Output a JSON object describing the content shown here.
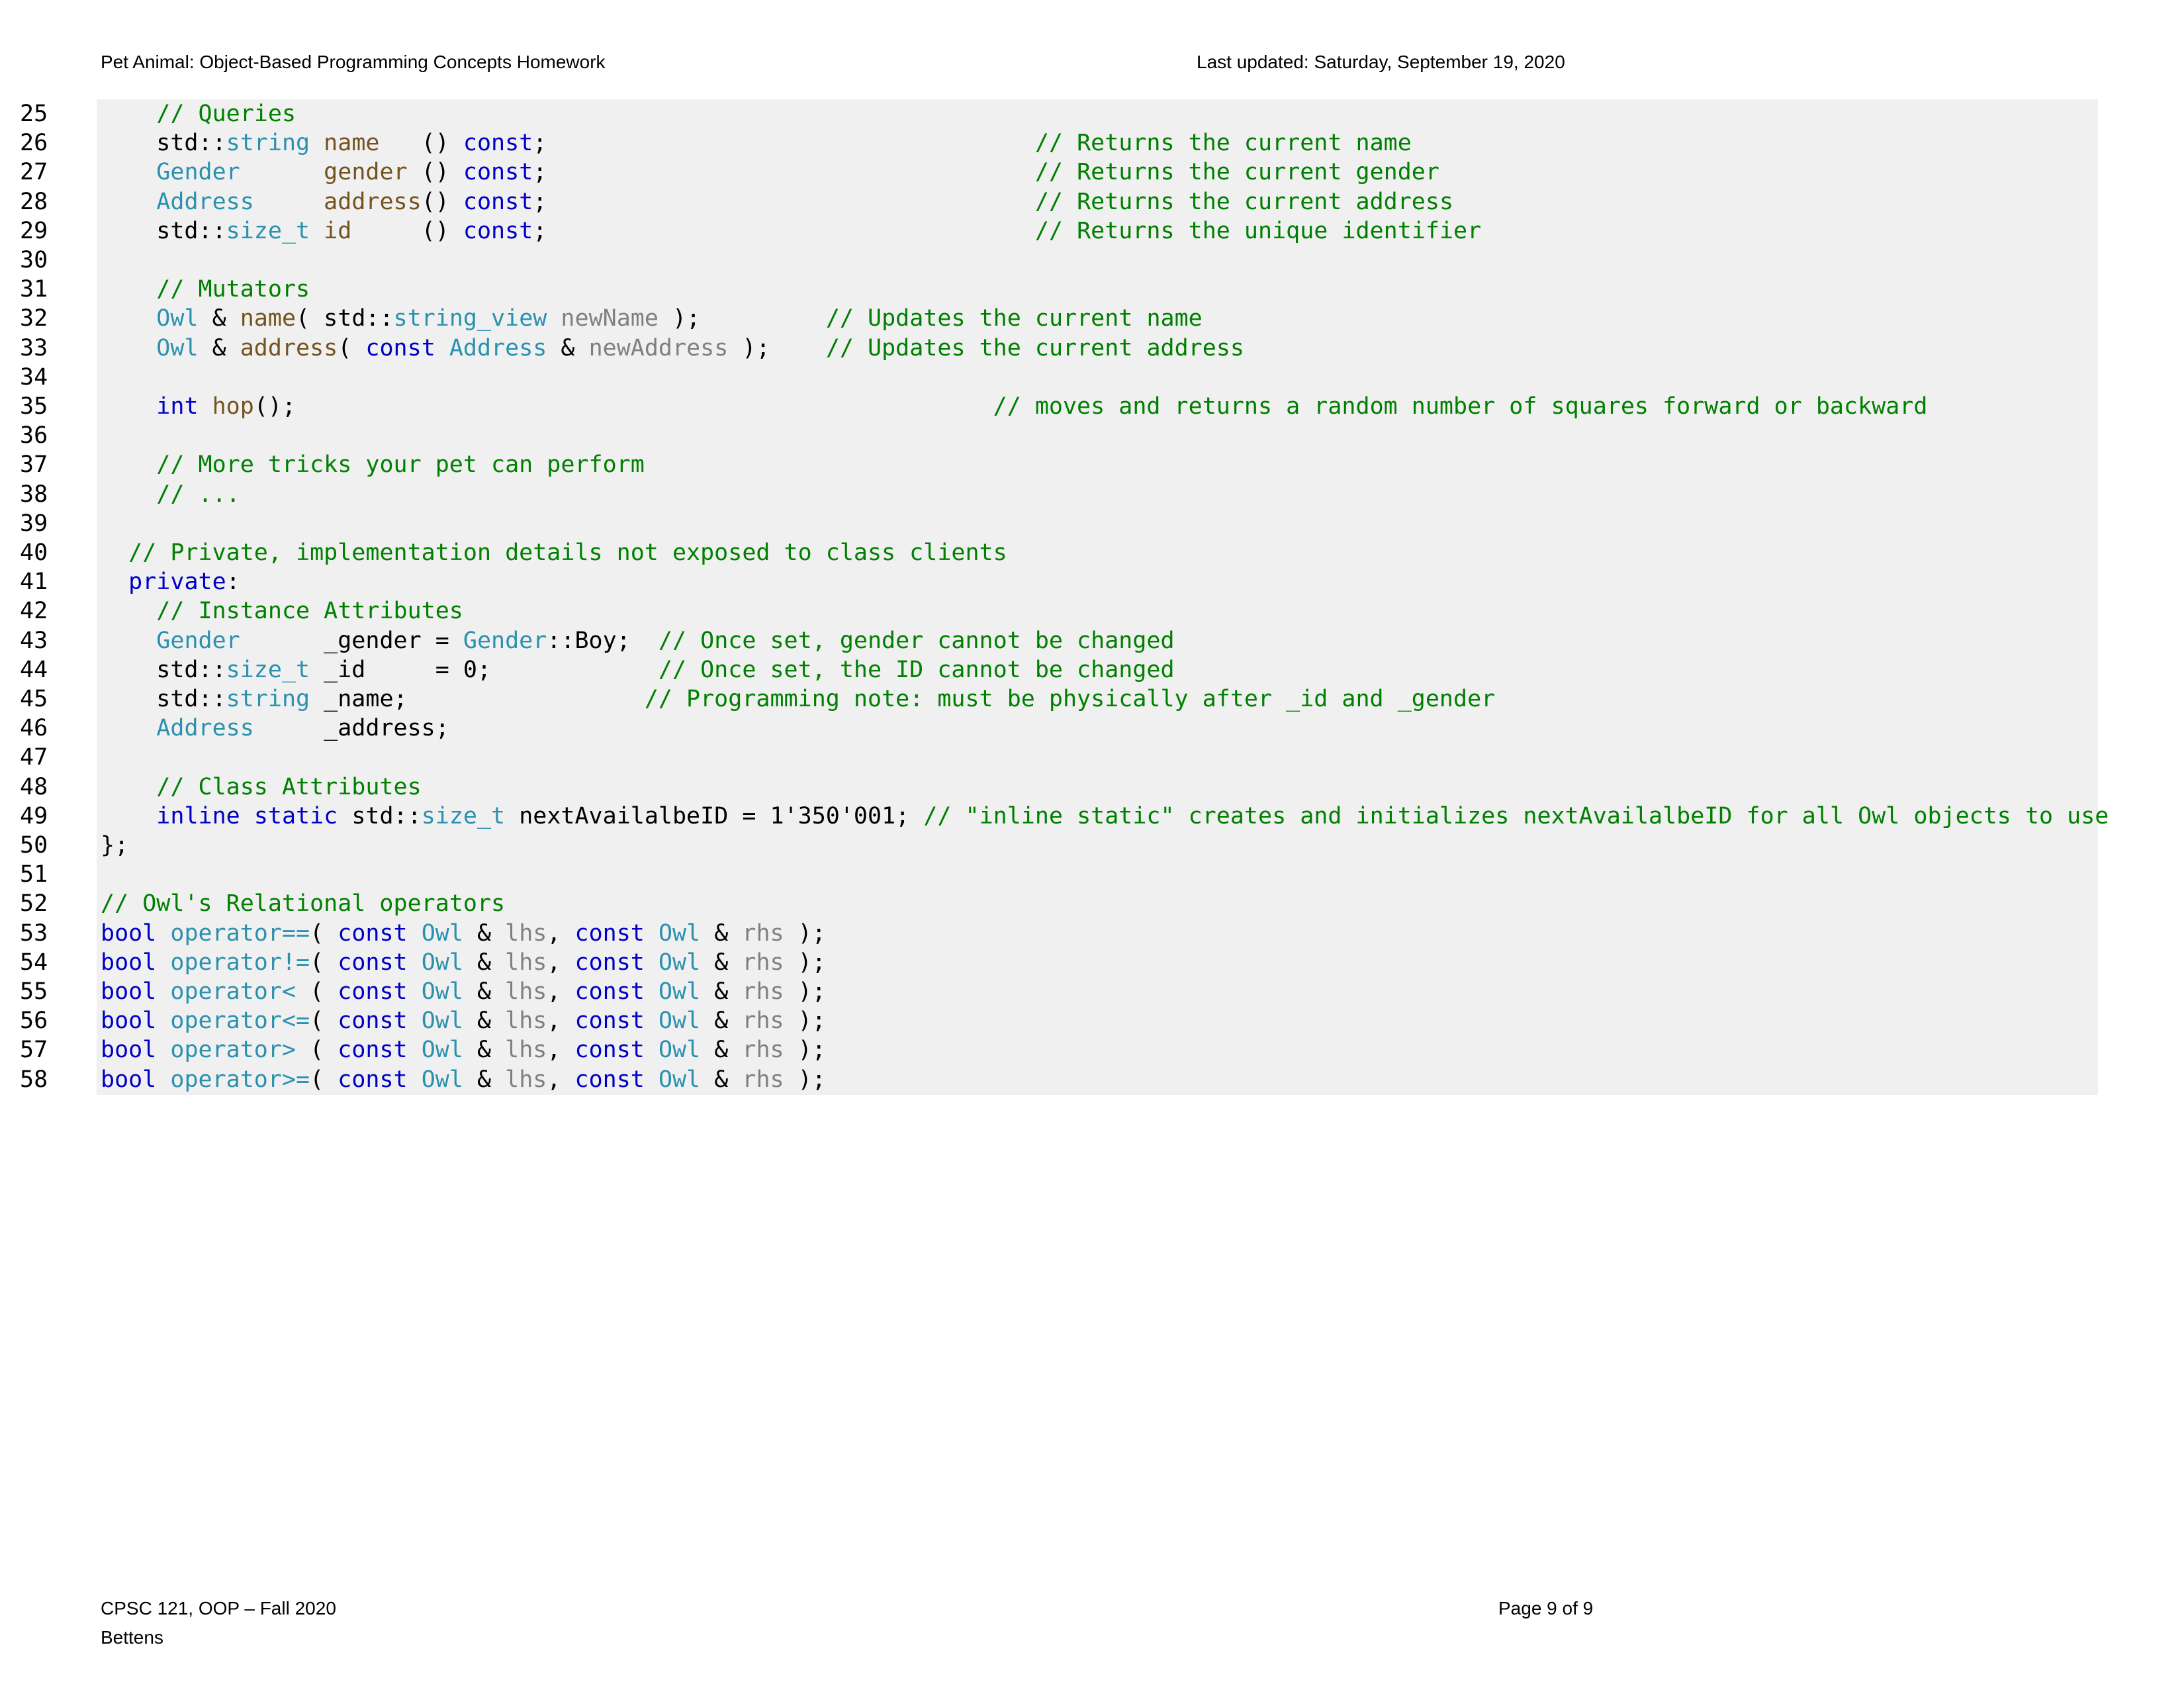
{
  "header": {
    "left": "Pet Animal: Object-Based Programming Concepts Homework",
    "right": "Last updated: Saturday, September 19, 2020"
  },
  "footer": {
    "course": "CPSC 121, OOP – Fall 2020",
    "author": "Bettens",
    "page": "Page 9 of 9"
  },
  "code": {
    "lines": [
      {
        "n": "25",
        "tokens": [
          {
            "t": "    "
          },
          {
            "t": "// Queries",
            "k": "comment"
          }
        ]
      },
      {
        "n": "26",
        "tokens": [
          {
            "t": "    std::"
          },
          {
            "t": "string",
            "k": "type"
          },
          {
            "t": " "
          },
          {
            "t": "name",
            "k": "func"
          },
          {
            "t": "   () "
          },
          {
            "t": "const",
            "k": "keyword"
          },
          {
            "t": ";                                   "
          },
          {
            "t": "// Returns the current name",
            "k": "comment"
          }
        ]
      },
      {
        "n": "27",
        "tokens": [
          {
            "t": "    "
          },
          {
            "t": "Gender",
            "k": "type"
          },
          {
            "t": "      "
          },
          {
            "t": "gender",
            "k": "func"
          },
          {
            "t": " () "
          },
          {
            "t": "const",
            "k": "keyword"
          },
          {
            "t": ";                                   "
          },
          {
            "t": "// Returns the current gender",
            "k": "comment"
          }
        ]
      },
      {
        "n": "28",
        "tokens": [
          {
            "t": "    "
          },
          {
            "t": "Address",
            "k": "type"
          },
          {
            "t": "     "
          },
          {
            "t": "address",
            "k": "func"
          },
          {
            "t": "() "
          },
          {
            "t": "const",
            "k": "keyword"
          },
          {
            "t": ";                                   "
          },
          {
            "t": "// Returns the current address",
            "k": "comment"
          }
        ]
      },
      {
        "n": "29",
        "tokens": [
          {
            "t": "    std::"
          },
          {
            "t": "size_t",
            "k": "type"
          },
          {
            "t": " "
          },
          {
            "t": "id",
            "k": "func"
          },
          {
            "t": "     () "
          },
          {
            "t": "const",
            "k": "keyword"
          },
          {
            "t": ";                                   "
          },
          {
            "t": "// Returns the unique identifier",
            "k": "comment"
          }
        ]
      },
      {
        "n": "30",
        "tokens": []
      },
      {
        "n": "31",
        "tokens": [
          {
            "t": "    "
          },
          {
            "t": "// Mutators",
            "k": "comment"
          }
        ]
      },
      {
        "n": "32",
        "tokens": [
          {
            "t": "    "
          },
          {
            "t": "Owl",
            "k": "type"
          },
          {
            "t": " & "
          },
          {
            "t": "name",
            "k": "func"
          },
          {
            "t": "( std::"
          },
          {
            "t": "string_view",
            "k": "type"
          },
          {
            "t": " "
          },
          {
            "t": "newName",
            "k": "param"
          },
          {
            "t": " );         "
          },
          {
            "t": "// Updates the current name",
            "k": "comment"
          }
        ]
      },
      {
        "n": "33",
        "tokens": [
          {
            "t": "    "
          },
          {
            "t": "Owl",
            "k": "type"
          },
          {
            "t": " & "
          },
          {
            "t": "address",
            "k": "func"
          },
          {
            "t": "( "
          },
          {
            "t": "const",
            "k": "keyword"
          },
          {
            "t": " "
          },
          {
            "t": "Address",
            "k": "type"
          },
          {
            "t": " & "
          },
          {
            "t": "newAddress",
            "k": "param"
          },
          {
            "t": " );    "
          },
          {
            "t": "// Updates the current address",
            "k": "comment"
          }
        ]
      },
      {
        "n": "34",
        "tokens": []
      },
      {
        "n": "35",
        "tokens": [
          {
            "t": "    "
          },
          {
            "t": "int",
            "k": "keyword"
          },
          {
            "t": " "
          },
          {
            "t": "hop",
            "k": "func"
          },
          {
            "t": "();                                                  "
          },
          {
            "t": "// moves and returns a random number of squares forward or backward",
            "k": "comment"
          }
        ]
      },
      {
        "n": "36",
        "tokens": []
      },
      {
        "n": "37",
        "tokens": [
          {
            "t": "    "
          },
          {
            "t": "// More tricks your pet can perform",
            "k": "comment"
          }
        ]
      },
      {
        "n": "38",
        "tokens": [
          {
            "t": "    "
          },
          {
            "t": "// ...",
            "k": "comment"
          }
        ]
      },
      {
        "n": "39",
        "tokens": []
      },
      {
        "n": "40",
        "tokens": [
          {
            "t": "  "
          },
          {
            "t": "// Private, implementation details not exposed to class clients",
            "k": "comment"
          }
        ]
      },
      {
        "n": "41",
        "tokens": [
          {
            "t": "  "
          },
          {
            "t": "private",
            "k": "keyword"
          },
          {
            "t": ":"
          }
        ]
      },
      {
        "n": "42",
        "tokens": [
          {
            "t": "    "
          },
          {
            "t": "// Instance Attributes",
            "k": "comment"
          }
        ]
      },
      {
        "n": "43",
        "tokens": [
          {
            "t": "    "
          },
          {
            "t": "Gender",
            "k": "type"
          },
          {
            "t": "      _gender = "
          },
          {
            "t": "Gender",
            "k": "type"
          },
          {
            "t": "::Boy;  "
          },
          {
            "t": "// Once set, gender cannot be changed",
            "k": "comment"
          }
        ]
      },
      {
        "n": "44",
        "tokens": [
          {
            "t": "    std::"
          },
          {
            "t": "size_t",
            "k": "type"
          },
          {
            "t": " _id     = 0;            "
          },
          {
            "t": "// Once set, the ID cannot be changed",
            "k": "comment"
          }
        ]
      },
      {
        "n": "45",
        "tokens": [
          {
            "t": "    std::"
          },
          {
            "t": "string",
            "k": "type"
          },
          {
            "t": " _name;                 "
          },
          {
            "t": "// Programming note: must be physically after _id and _gender",
            "k": "comment"
          }
        ]
      },
      {
        "n": "46",
        "tokens": [
          {
            "t": "    "
          },
          {
            "t": "Address",
            "k": "type"
          },
          {
            "t": "     _address;"
          }
        ]
      },
      {
        "n": "47",
        "tokens": []
      },
      {
        "n": "48",
        "tokens": [
          {
            "t": "    "
          },
          {
            "t": "// Class Attributes",
            "k": "comment"
          }
        ]
      },
      {
        "n": "49",
        "tokens": [
          {
            "t": "    "
          },
          {
            "t": "inline",
            "k": "keyword"
          },
          {
            "t": " "
          },
          {
            "t": "static",
            "k": "keyword"
          },
          {
            "t": " std::"
          },
          {
            "t": "size_t",
            "k": "type"
          },
          {
            "t": " nextAvailalbeID = 1'350'001; "
          },
          {
            "t": "// \"inline static\" creates and initializes nextAvailalbeID for all Owl objects to use",
            "k": "comment"
          }
        ]
      },
      {
        "n": "50",
        "tokens": [
          {
            "t": "};"
          }
        ]
      },
      {
        "n": "51",
        "tokens": []
      },
      {
        "n": "52",
        "tokens": [
          {
            "t": "// Owl's Relational operators",
            "k": "comment"
          }
        ]
      },
      {
        "n": "53",
        "tokens": [
          {
            "t": "bool",
            "k": "keyword"
          },
          {
            "t": " "
          },
          {
            "t": "operator==",
            "k": "type"
          },
          {
            "t": "( "
          },
          {
            "t": "const",
            "k": "keyword"
          },
          {
            "t": " "
          },
          {
            "t": "Owl",
            "k": "type"
          },
          {
            "t": " & "
          },
          {
            "t": "lhs",
            "k": "param"
          },
          {
            "t": ", "
          },
          {
            "t": "const",
            "k": "keyword"
          },
          {
            "t": " "
          },
          {
            "t": "Owl",
            "k": "type"
          },
          {
            "t": " & "
          },
          {
            "t": "rhs",
            "k": "param"
          },
          {
            "t": " );"
          }
        ]
      },
      {
        "n": "54",
        "tokens": [
          {
            "t": "bool",
            "k": "keyword"
          },
          {
            "t": " "
          },
          {
            "t": "operator!=",
            "k": "type"
          },
          {
            "t": "( "
          },
          {
            "t": "const",
            "k": "keyword"
          },
          {
            "t": " "
          },
          {
            "t": "Owl",
            "k": "type"
          },
          {
            "t": " & "
          },
          {
            "t": "lhs",
            "k": "param"
          },
          {
            "t": ", "
          },
          {
            "t": "const",
            "k": "keyword"
          },
          {
            "t": " "
          },
          {
            "t": "Owl",
            "k": "type"
          },
          {
            "t": " & "
          },
          {
            "t": "rhs",
            "k": "param"
          },
          {
            "t": " );"
          }
        ]
      },
      {
        "n": "55",
        "tokens": [
          {
            "t": "bool",
            "k": "keyword"
          },
          {
            "t": " "
          },
          {
            "t": "operator<",
            "k": "type"
          },
          {
            "t": " ( "
          },
          {
            "t": "const",
            "k": "keyword"
          },
          {
            "t": " "
          },
          {
            "t": "Owl",
            "k": "type"
          },
          {
            "t": " & "
          },
          {
            "t": "lhs",
            "k": "param"
          },
          {
            "t": ", "
          },
          {
            "t": "const",
            "k": "keyword"
          },
          {
            "t": " "
          },
          {
            "t": "Owl",
            "k": "type"
          },
          {
            "t": " & "
          },
          {
            "t": "rhs",
            "k": "param"
          },
          {
            "t": " );"
          }
        ]
      },
      {
        "n": "56",
        "tokens": [
          {
            "t": "bool",
            "k": "keyword"
          },
          {
            "t": " "
          },
          {
            "t": "operator<=",
            "k": "type"
          },
          {
            "t": "( "
          },
          {
            "t": "const",
            "k": "keyword"
          },
          {
            "t": " "
          },
          {
            "t": "Owl",
            "k": "type"
          },
          {
            "t": " & "
          },
          {
            "t": "lhs",
            "k": "param"
          },
          {
            "t": ", "
          },
          {
            "t": "const",
            "k": "keyword"
          },
          {
            "t": " "
          },
          {
            "t": "Owl",
            "k": "type"
          },
          {
            "t": " & "
          },
          {
            "t": "rhs",
            "k": "param"
          },
          {
            "t": " );"
          }
        ]
      },
      {
        "n": "57",
        "tokens": [
          {
            "t": "bool",
            "k": "keyword"
          },
          {
            "t": " "
          },
          {
            "t": "operator>",
            "k": "type"
          },
          {
            "t": " ( "
          },
          {
            "t": "const",
            "k": "keyword"
          },
          {
            "t": " "
          },
          {
            "t": "Owl",
            "k": "type"
          },
          {
            "t": " & "
          },
          {
            "t": "lhs",
            "k": "param"
          },
          {
            "t": ", "
          },
          {
            "t": "const",
            "k": "keyword"
          },
          {
            "t": " "
          },
          {
            "t": "Owl",
            "k": "type"
          },
          {
            "t": " & "
          },
          {
            "t": "rhs",
            "k": "param"
          },
          {
            "t": " );"
          }
        ]
      },
      {
        "n": "58",
        "tokens": [
          {
            "t": "bool",
            "k": "keyword"
          },
          {
            "t": " "
          },
          {
            "t": "operator>=",
            "k": "type"
          },
          {
            "t": "( "
          },
          {
            "t": "const",
            "k": "keyword"
          },
          {
            "t": " "
          },
          {
            "t": "Owl",
            "k": "type"
          },
          {
            "t": " & "
          },
          {
            "t": "lhs",
            "k": "param"
          },
          {
            "t": ", "
          },
          {
            "t": "const",
            "k": "keyword"
          },
          {
            "t": " "
          },
          {
            "t": "Owl",
            "k": "type"
          },
          {
            "t": " & "
          },
          {
            "t": "rhs",
            "k": "param"
          },
          {
            "t": " );"
          }
        ]
      }
    ]
  }
}
